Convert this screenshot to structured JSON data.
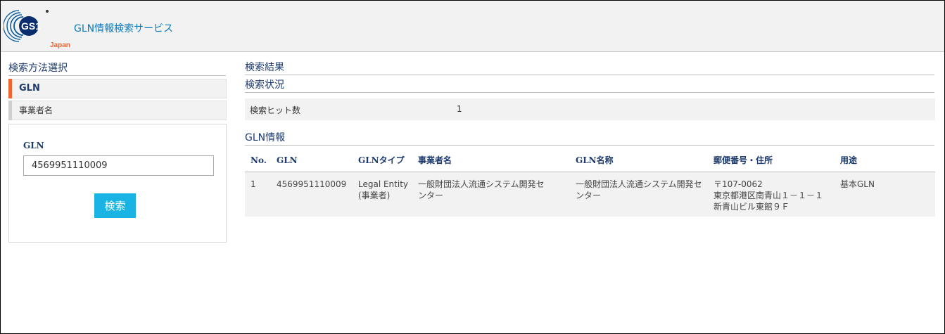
{
  "header": {
    "logo_text": "GS1",
    "logo_sub": "Japan",
    "service_title": "GLN情報検索サービス",
    "brand_color": "#f26334",
    "accent_color": "#1ab4e4"
  },
  "left": {
    "heading": "検索方法選択",
    "methods": [
      {
        "label": "GLN",
        "active": true
      },
      {
        "label": "事業者名",
        "active": false
      }
    ],
    "field_label": "GLN",
    "gln_value": "4569951110009",
    "search_button": "検索"
  },
  "right": {
    "results_heading": "検索結果",
    "status_heading": "検索状況",
    "hit_label": "検索ヒット数",
    "hit_count": "1",
    "gln_info_heading": "GLN情報",
    "table": {
      "columns": [
        "No.",
        "GLN",
        "GLNタイプ",
        "事業者名",
        "GLN名称",
        "郵便番号・住所",
        "用途"
      ],
      "rows": [
        {
          "no": "1",
          "gln": "4569951110009",
          "type_line1": "Legal Entity",
          "type_line2": "(事業者)",
          "company": "一般財団法人流通システム開発センター",
          "gln_name": "一般財団法人流通システム開発センター",
          "postal": "〒107-0062",
          "address1": "東京都港区南青山１－１－１",
          "address2": "新青山ビル東館９Ｆ",
          "usage": "基本GLN"
        }
      ]
    }
  }
}
